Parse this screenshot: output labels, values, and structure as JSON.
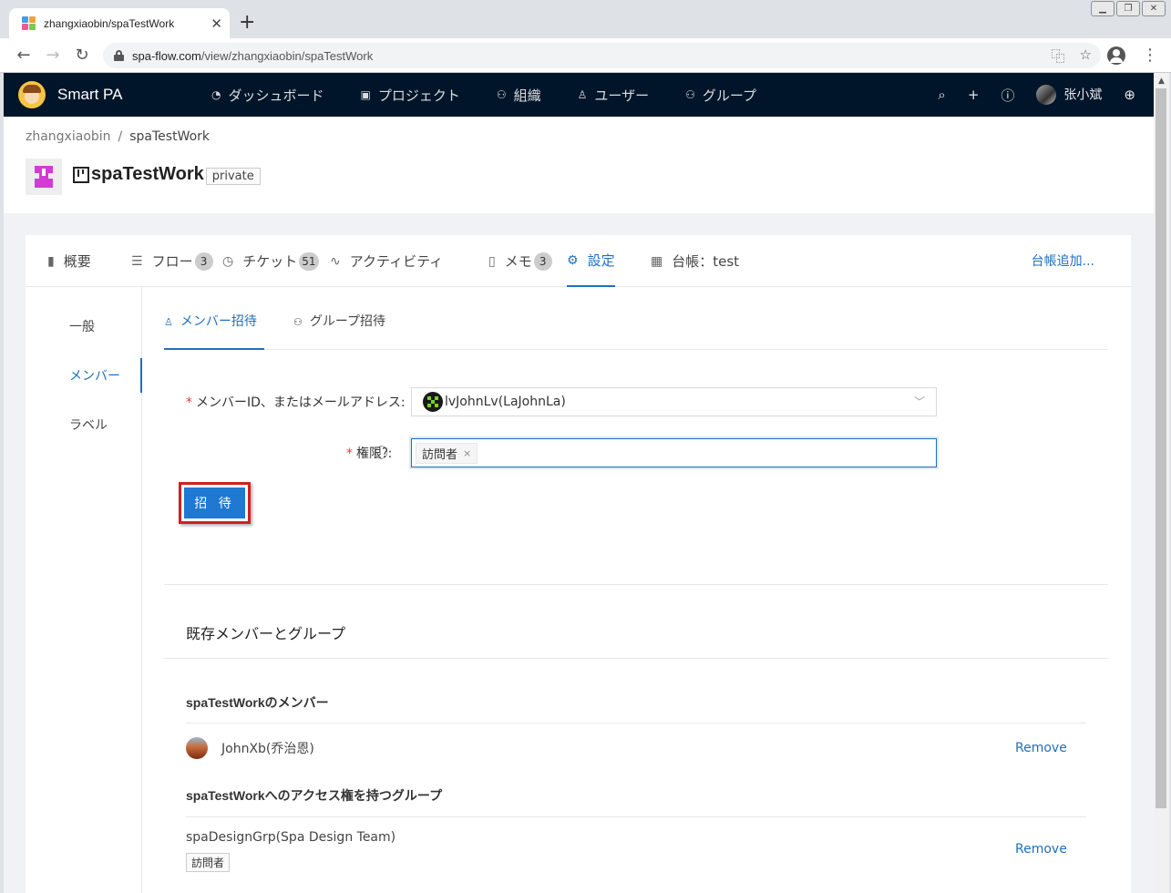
{
  "browser": {
    "tab_title": "zhangxiaobin/spaTestWork",
    "url_domain": "spa-flow.com",
    "url_path": "/view/zhangxiaobin/spaTestWork"
  },
  "appnav": {
    "brand": "Smart PA",
    "items": [
      {
        "label": "ダッシュボード",
        "icon": "dashboard-icon"
      },
      {
        "label": "プロジェクト",
        "icon": "project-icon"
      },
      {
        "label": "組織",
        "icon": "organization-icon"
      },
      {
        "label": "ユーザー",
        "icon": "user-icon"
      },
      {
        "label": "グループ",
        "icon": "group-icon"
      }
    ],
    "username": "张小斌"
  },
  "breadcrumb": {
    "owner": "zhangxiaobin",
    "project": "spaTestWork"
  },
  "project": {
    "name": "spaTestWork",
    "visibility": "private"
  },
  "tabs": {
    "overview": "概要",
    "flow": "フロー",
    "flow_count": "3",
    "ticket": "チケット",
    "ticket_count": "51",
    "activity": "アクティビティ",
    "memo": "メモ",
    "memo_count": "3",
    "settings": "設定",
    "ledger": "台帳：test",
    "add_ledger": "台帳追加..."
  },
  "sidemenu": {
    "general": "一般",
    "member": "メンバー",
    "label": "ラベル"
  },
  "subtabs": {
    "member_invite": "メンバー招待",
    "group_invite": "グループ招待"
  },
  "form": {
    "member_label": "メンバーID、またはメールアドレス:",
    "member_value": "lvJohnLv(LaJohnLa)",
    "permission_label": "権限",
    "permission_colon": ":",
    "permission_tag": "訪問者",
    "invite_button": "招 待"
  },
  "existing": {
    "title": "既存メンバーとグループ",
    "members_heading": "spaTestWorkのメンバー",
    "member_name": "JohnXb(乔治恩)",
    "groups_heading": "spaTestWorkへのアクセス権を持つグループ",
    "group_name": "spaDesignGrp(Spa Design Team)",
    "group_permission": "訪問者",
    "remove_label": "Remove"
  }
}
